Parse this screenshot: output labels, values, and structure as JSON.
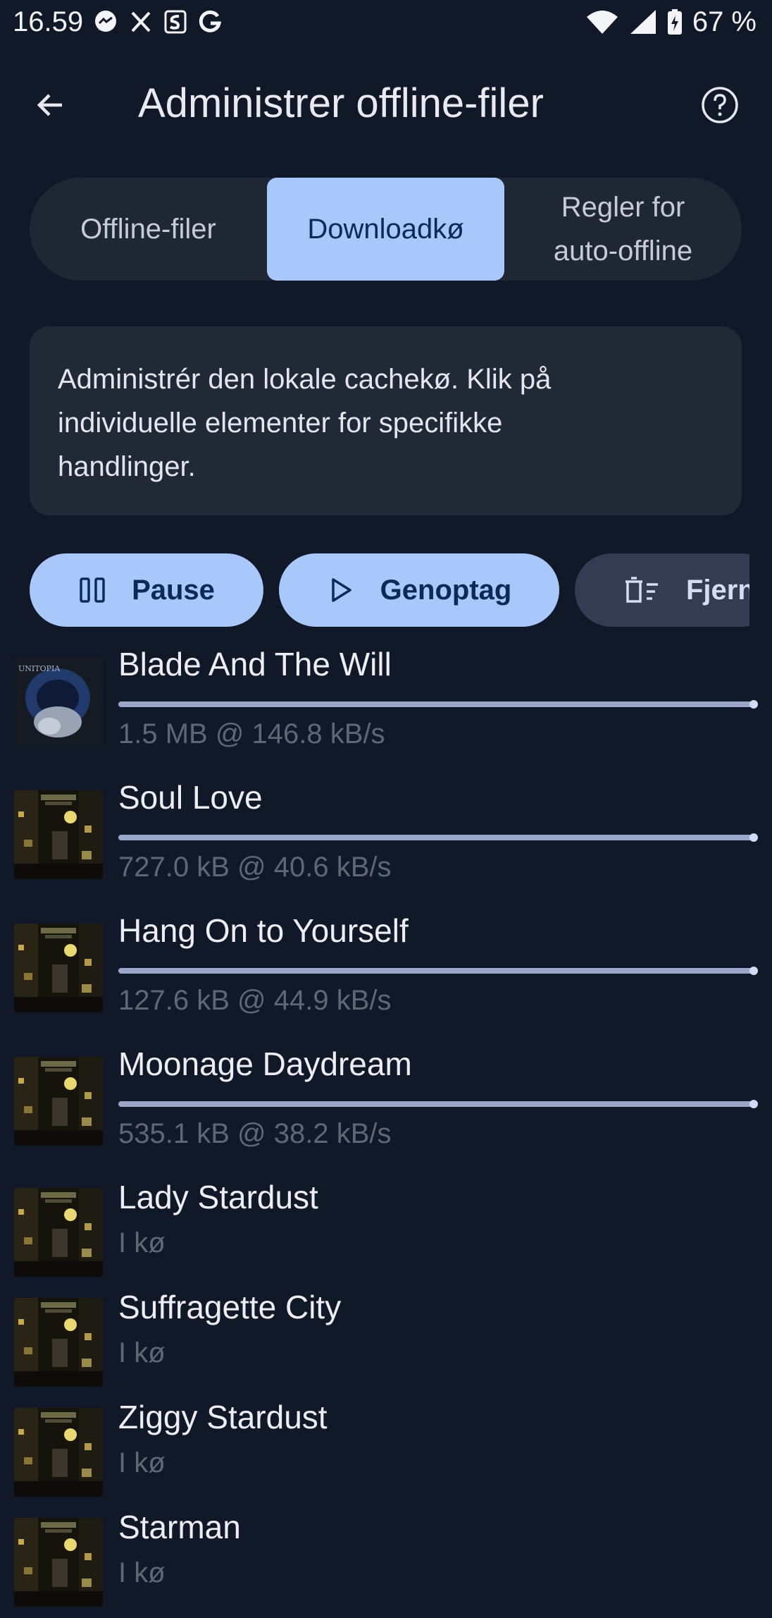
{
  "status_bar": {
    "time": "16.59",
    "battery": "67 %",
    "left_icons": [
      "messenger-icon",
      "x-icon",
      "shazam-icon",
      "google-icon"
    ],
    "right_icons": [
      "wifi-icon",
      "signal-icon",
      "battery-icon"
    ]
  },
  "header": {
    "title": "Administrer offline-filer"
  },
  "tabs": [
    {
      "label": "Offline-filer",
      "selected": false
    },
    {
      "label": "Downloadkø",
      "selected": true
    },
    {
      "label_line1": "Regler for",
      "label_line2": "auto-offline",
      "selected": false
    }
  ],
  "info": {
    "text_line1": "Administrér den lokale cachekø. Klik på",
    "text_line2": "individuelle elementer for specifikke",
    "text_line3": "handlinger."
  },
  "actions": {
    "pause": "Pause",
    "resume": "Genoptag",
    "remove": "Fjern"
  },
  "tracks": [
    {
      "title": "Blade And The Will",
      "subtitle": "1.5 MB @ 146.8 kB/s",
      "progress": 1.0,
      "cover": "blue"
    },
    {
      "title": "Soul Love",
      "subtitle": "727.0 kB @ 40.6 kB/s",
      "progress": 1.0,
      "cover": "ziggy"
    },
    {
      "title": "Hang On to Yourself",
      "subtitle": "127.6 kB @ 44.9 kB/s",
      "progress": 1.0,
      "cover": "ziggy"
    },
    {
      "title": "Moonage Daydream",
      "subtitle": "535.1 kB @ 38.2 kB/s",
      "progress": 1.0,
      "cover": "ziggy"
    },
    {
      "title": "Lady Stardust",
      "subtitle": "I kø",
      "progress": null,
      "cover": "ziggy"
    },
    {
      "title": "Suffragette City",
      "subtitle": "I kø",
      "progress": null,
      "cover": "ziggy"
    },
    {
      "title": "Ziggy Stardust",
      "subtitle": "I kø",
      "progress": null,
      "cover": "ziggy"
    },
    {
      "title": "Starman",
      "subtitle": "I kø",
      "progress": null,
      "cover": "ziggy"
    }
  ],
  "colors": {
    "background": "#111827",
    "accent": "#a8c7fa",
    "accent_text": "#0b2a57"
  }
}
